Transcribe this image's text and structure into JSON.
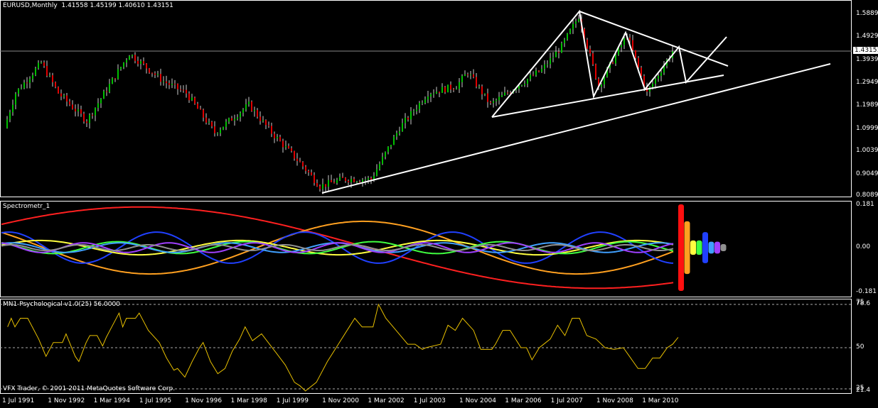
{
  "header": {
    "symbol": "EURUSD,Monthly",
    "ohlc": "1.41558 1.45199 1.40610 1.43151"
  },
  "colors": {
    "bull": "#00c000",
    "bear": "#e00000",
    "candle_wick": "#ffffff",
    "psych_line": "#e8c000"
  },
  "chart_data": [
    {
      "type": "candlestick",
      "title": "EURUSD,Monthly",
      "current_price": 1.43151,
      "y_ticks": [
        "1.58890",
        "1.49290",
        "1.39390",
        "1.29490",
        "1.19890",
        "1.09990",
        "1.00390",
        "0.90490",
        "0.80890"
      ],
      "current_label": "1.43151",
      "ylim": [
        0.8089,
        1.5889
      ],
      "x_ticks": [
        "1 Jul 1991",
        "1 Nov 1992",
        "1 Mar 1994",
        "1 Jul 1995",
        "1 Nov 1996",
        "1 Mar 1998",
        "1 Jul 1999",
        "1 Nov 2000",
        "1 Mar 2002",
        "1 Jul 2003",
        "1 Nov 2004",
        "1 Mar 2006",
        "1 Jul 2007",
        "1 Nov 2008",
        "1 Mar 2010"
      ],
      "approx_closes_month_from_jul1991": [
        [
          -4,
          1.1
        ],
        [
          0,
          1.25
        ],
        [
          9,
          1.38
        ],
        [
          15,
          1.25
        ],
        [
          25,
          1.13
        ],
        [
          40,
          1.42
        ],
        [
          52,
          1.3
        ],
        [
          60,
          1.25
        ],
        [
          70,
          1.08
        ],
        [
          82,
          1.2
        ],
        [
          90,
          1.08
        ],
        [
          100,
          0.95
        ],
        [
          107,
          0.85
        ],
        [
          115,
          0.88
        ],
        [
          125,
          0.88
        ],
        [
          135,
          1.1
        ],
        [
          145,
          1.25
        ],
        [
          155,
          1.28
        ],
        [
          159,
          1.34
        ],
        [
          167,
          1.2
        ],
        [
          175,
          1.27
        ],
        [
          185,
          1.35
        ],
        [
          192,
          1.45
        ],
        [
          198,
          1.58
        ],
        [
          205,
          1.28
        ],
        [
          215,
          1.5
        ],
        [
          222,
          1.25
        ],
        [
          231,
          1.43
        ]
      ]
    },
    {
      "type": "line",
      "title": "Spectrometr_1",
      "y_ticks": [
        "0.181",
        "0.00",
        "-0.181"
      ],
      "ylim": [
        -0.181,
        0.181
      ],
      "series": [
        {
          "color": "#ff2020",
          "amp": 0.17,
          "period": 320,
          "phase": 0.6
        },
        {
          "color": "#ffa020",
          "amp": 0.11,
          "period": 150,
          "phase": 2.5
        },
        {
          "color": "#2040ff",
          "amp": 0.065,
          "period": 52,
          "phase": 1.2
        },
        {
          "color": "#ffff40",
          "amp": 0.03,
          "period": 70,
          "phase": 0.3
        },
        {
          "color": "#40ff40",
          "amp": 0.025,
          "period": 45,
          "phase": 2.1
        },
        {
          "color": "#40a0ff",
          "amp": 0.02,
          "period": 38,
          "phase": 0.9
        },
        {
          "color": "#a040ff",
          "amp": 0.02,
          "period": 30,
          "phase": 1.7
        },
        {
          "color": "#909090",
          "amp": 0.012,
          "period": 24,
          "phase": 0.5
        }
      ],
      "spectrum_bars": [
        {
          "color": "#ff1010",
          "value": 0.181
        },
        {
          "color": "#ffa020",
          "value": 0.11
        },
        {
          "color": "#ffff40",
          "value": 0.03
        },
        {
          "color": "#40ff40",
          "value": 0.03
        },
        {
          "color": "#2040ff",
          "value": 0.065
        },
        {
          "color": "#40a0ff",
          "value": 0.025
        },
        {
          "color": "#a040ff",
          "value": 0.025
        },
        {
          "color": "#909090",
          "value": 0.015
        }
      ]
    },
    {
      "type": "line",
      "title": "MN1 Psychological-v1.0(25) 56.0000",
      "y_ticks": [
        "78.6",
        "75",
        "50",
        "25",
        "21.4"
      ],
      "ylim": [
        21.4,
        78.6
      ],
      "approx_values_month_from_jul1991": [
        [
          3,
          62
        ],
        [
          5,
          67
        ],
        [
          7,
          62
        ],
        [
          10,
          67
        ],
        [
          14,
          67
        ],
        [
          20,
          55
        ],
        [
          24,
          45
        ],
        [
          28,
          53
        ],
        [
          33,
          53
        ],
        [
          35,
          58
        ],
        [
          40,
          45
        ],
        [
          42,
          42
        ],
        [
          46,
          53
        ],
        [
          48,
          57
        ],
        [
          52,
          57
        ],
        [
          55,
          51
        ],
        [
          57,
          56
        ],
        [
          60,
          62
        ],
        [
          64,
          70
        ],
        [
          66,
          62
        ],
        [
          68,
          67
        ],
        [
          73,
          67
        ],
        [
          75,
          70
        ],
        [
          80,
          60
        ],
        [
          86,
          53
        ],
        [
          90,
          44
        ],
        [
          94,
          37
        ],
        [
          96,
          38
        ],
        [
          100,
          33
        ],
        [
          104,
          42
        ],
        [
          108,
          50
        ],
        [
          110,
          53
        ],
        [
          114,
          42
        ],
        [
          118,
          35
        ],
        [
          122,
          38
        ],
        [
          126,
          48
        ],
        [
          130,
          55
        ],
        [
          133,
          62
        ],
        [
          137,
          54
        ],
        [
          142,
          58
        ],
        [
          150,
          47
        ],
        [
          155,
          40
        ],
        [
          160,
          30
        ],
        [
          163,
          28
        ],
        [
          166,
          25
        ],
        [
          172,
          30
        ],
        [
          178,
          42
        ],
        [
          184,
          52
        ],
        [
          190,
          62
        ],
        [
          193,
          67
        ],
        [
          197,
          62
        ],
        [
          203,
          62
        ],
        [
          206,
          75
        ],
        [
          210,
          67
        ],
        [
          214,
          62
        ],
        [
          218,
          57
        ],
        [
          222,
          52
        ],
        [
          226,
          52
        ],
        [
          230,
          49
        ],
        [
          232,
          50
        ],
        [
          240,
          52
        ],
        [
          244,
          63
        ],
        [
          248,
          60
        ],
        [
          252,
          67
        ],
        [
          258,
          60
        ],
        [
          262,
          49
        ],
        [
          268,
          49
        ],
        [
          270,
          52
        ],
        [
          274,
          60
        ],
        [
          278,
          60
        ],
        [
          284,
          50
        ],
        [
          287,
          50
        ],
        [
          290,
          43
        ],
        [
          294,
          50
        ],
        [
          300,
          55
        ],
        [
          304,
          63
        ],
        [
          308,
          57
        ],
        [
          312,
          67
        ],
        [
          316,
          67
        ],
        [
          320,
          57
        ],
        [
          325,
          55
        ],
        [
          330,
          50
        ],
        [
          335,
          49
        ],
        [
          340,
          50
        ],
        [
          344,
          44
        ],
        [
          348,
          38
        ],
        [
          352,
          38
        ],
        [
          356,
          44
        ],
        [
          360,
          44
        ],
        [
          364,
          50
        ],
        [
          367,
          52
        ],
        [
          370,
          56
        ]
      ],
      "label_footer": "VFX Trader, © 2001-2011 MetaQuotes Software Corp."
    }
  ]
}
